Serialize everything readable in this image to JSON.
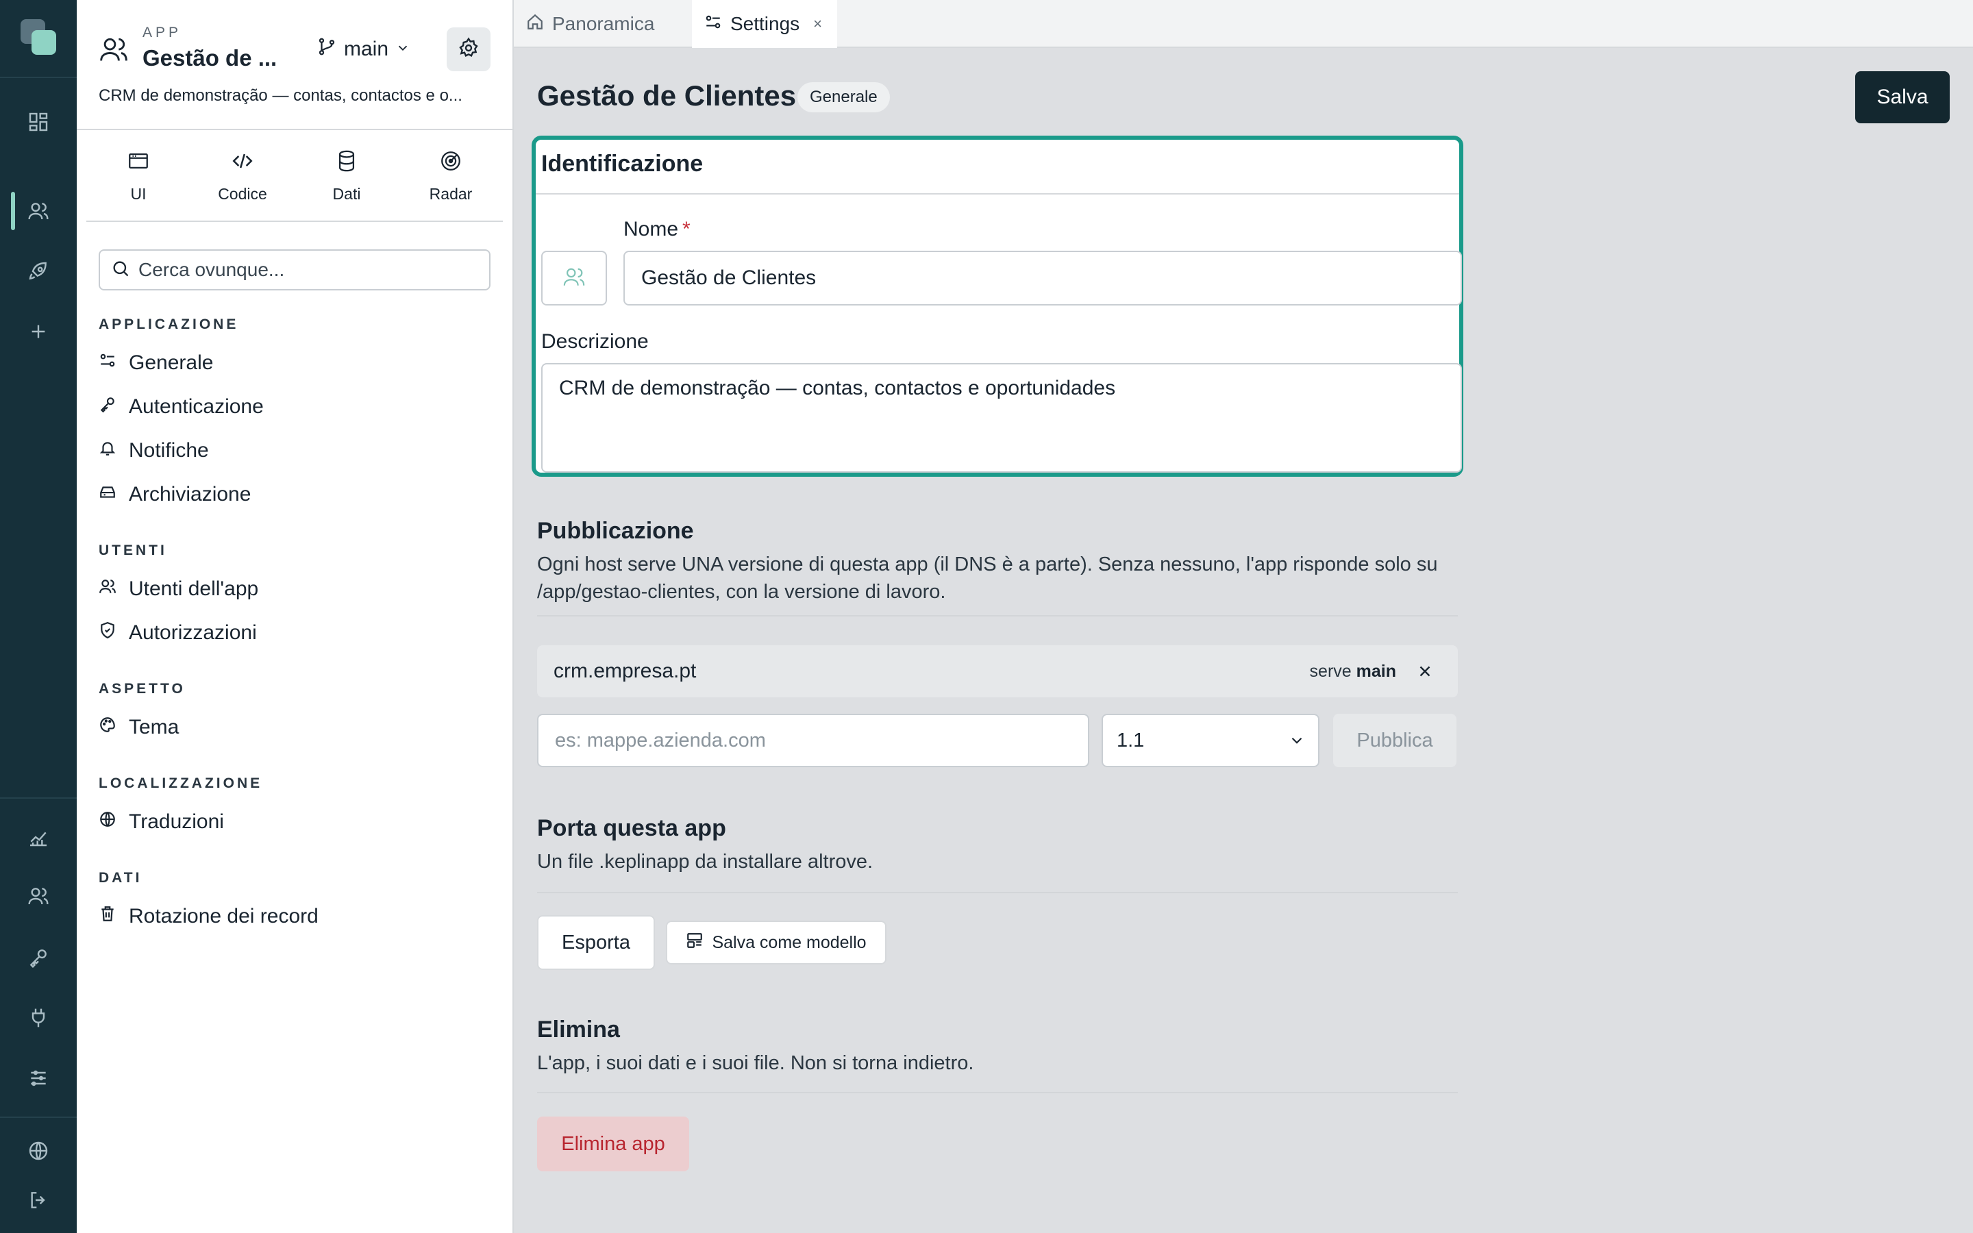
{
  "rail": {
    "items": [
      "grid-icon",
      "users-icon",
      "rocket-icon",
      "plus-icon",
      "chart-icon",
      "users-icon",
      "key-icon",
      "plug-icon",
      "sliders-icon",
      "globe-icon",
      "logout-icon"
    ],
    "active": "users-icon"
  },
  "app": {
    "kicker": "APP",
    "name": "Gestão de ...",
    "branch": "main",
    "description": "CRM de demonstração — contas, contactos e o..."
  },
  "side_tabs": [
    {
      "label": "UI",
      "icon": "window-icon"
    },
    {
      "label": "Codice",
      "icon": "code-icon"
    },
    {
      "label": "Dati",
      "icon": "database-icon"
    },
    {
      "label": "Radar",
      "icon": "radar-icon"
    }
  ],
  "search": {
    "placeholder": "Cerca ovunque..."
  },
  "nav": {
    "sections": [
      {
        "title": "APPLICAZIONE",
        "items": [
          {
            "label": "Generale",
            "icon": "sliders-icon"
          },
          {
            "label": "Autenticazione",
            "icon": "key-icon"
          },
          {
            "label": "Notifiche",
            "icon": "bell-icon"
          },
          {
            "label": "Archiviazione",
            "icon": "storage-icon"
          }
        ]
      },
      {
        "title": "UTENTI",
        "items": [
          {
            "label": "Utenti dell'app",
            "icon": "users-icon"
          },
          {
            "label": "Autorizzazioni",
            "icon": "shield-icon"
          }
        ]
      },
      {
        "title": "ASPETTO",
        "items": [
          {
            "label": "Tema",
            "icon": "palette-icon"
          }
        ]
      },
      {
        "title": "LOCALIZZAZIONE",
        "items": [
          {
            "label": "Traduzioni",
            "icon": "globe-icon"
          }
        ]
      },
      {
        "title": "DATI",
        "items": [
          {
            "label": "Rotazione dei record",
            "icon": "trash-icon"
          }
        ]
      }
    ]
  },
  "tabs": {
    "panoramica": "Panoramica",
    "settings": "Settings",
    "close": "×"
  },
  "page": {
    "title": "Gestão de Clientes",
    "badge": "Generale",
    "save": "Salva"
  },
  "ident": {
    "title": "Identificazione",
    "name_label": "Nome",
    "required_mark": "*",
    "name_value": "Gestão de Clientes",
    "desc_label": "Descrizione",
    "desc_value": "CRM de demonstração — contas, contactos e oportunidades"
  },
  "publish": {
    "title": "Pubblicazione",
    "text": "Ogni host serve UNA versione di questa app (il DNS è a parte). Senza nessuno, l'app risponde solo su /app/gestao-clientes, con la versione di lavoro.",
    "host": "crm.empresa.pt",
    "serve_prefix": "serve",
    "serve_branch": "main",
    "input_placeholder": "es: mappe.azienda.com",
    "version": "1.1",
    "button": "Pubblica"
  },
  "port": {
    "title": "Porta questa app",
    "text": "Un file .keplinapp da installare altrove.",
    "export": "Esporta",
    "template": "Salva come modello"
  },
  "delete": {
    "title": "Elimina",
    "text": "L'app, i suoi dati e i suoi file. Non si torna indietro.",
    "button": "Elimina app"
  },
  "colors": {
    "rail": "#16303a",
    "accent": "#1a9a8a",
    "primary_button": "#13272f",
    "danger_bg": "#eccdcf",
    "danger_text": "#b8252f"
  }
}
